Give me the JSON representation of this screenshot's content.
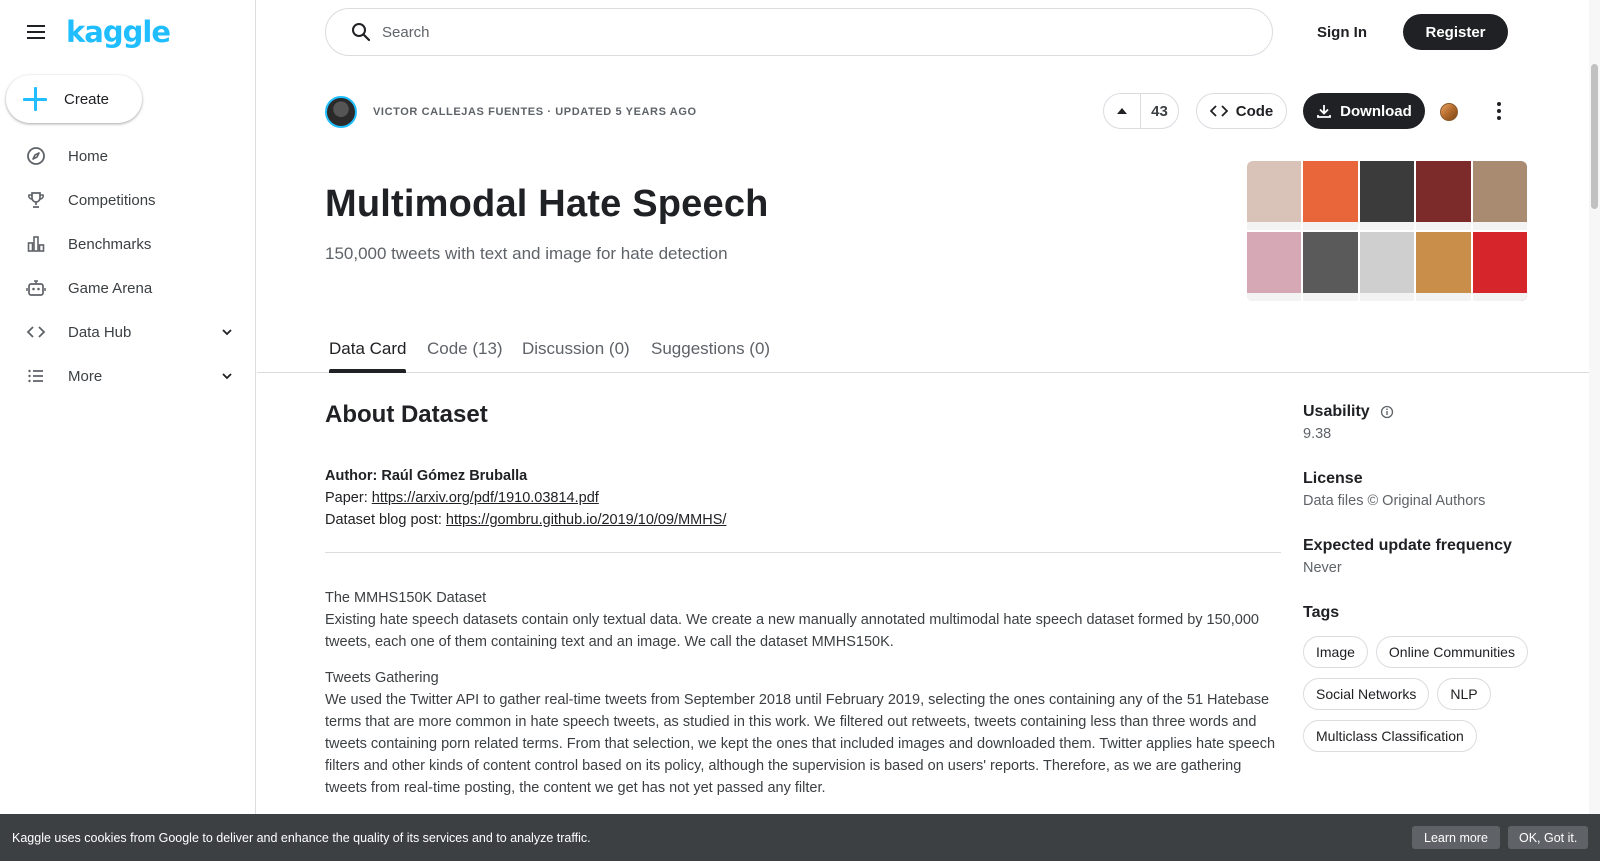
{
  "brand": {
    "logo_text": "kaggle",
    "accent": "#20beff"
  },
  "sidebar": {
    "create_label": "Create",
    "items": [
      {
        "label": "Home",
        "icon": "compass-icon"
      },
      {
        "label": "Competitions",
        "icon": "trophy-icon"
      },
      {
        "label": "Benchmarks",
        "icon": "bar-chart-icon"
      },
      {
        "label": "Game Arena",
        "icon": "robot-icon"
      },
      {
        "label": "Data Hub",
        "icon": "code-brackets-icon",
        "expandable": true
      },
      {
        "label": "More",
        "icon": "list-icon",
        "expandable": true
      }
    ]
  },
  "header": {
    "search_placeholder": "Search",
    "sign_in": "Sign In",
    "register": "Register"
  },
  "dataset": {
    "owner_line": "VICTOR CALLEJAS FUENTES · UPDATED 5 YEARS AGO",
    "votes": "43",
    "code_label": "Code",
    "download_label": "Download",
    "title": "Multimodal Hate Speech",
    "subtitle": "150,000 tweets with text and image for hate detection"
  },
  "tabs": [
    {
      "label": "Data Card",
      "active": true
    },
    {
      "label": "Code (13)"
    },
    {
      "label": "Discussion (0)"
    },
    {
      "label": "Suggestions (0)"
    }
  ],
  "about": {
    "heading": "About Dataset",
    "author": "Author: Raúl Gómez Bruballa",
    "paper_prefix": "Paper: ",
    "paper_link": "https://arxiv.org/pdf/1910.03814.pdf",
    "blog_prefix": "Dataset blog post: ",
    "blog_link": "https://gombru.github.io/2019/10/09/MMHS/",
    "p1_title": "The MMHS150K Dataset",
    "p1_body": "Existing hate speech datasets contain only textual data. We create a new manually annotated multimodal hate speech dataset formed by 150,000 tweets, each one of them containing text and an image. We call the dataset MMHS150K.",
    "p2_title": "Tweets Gathering",
    "p2_body": "We used the Twitter API to gather real-time tweets from September 2018 until February 2019, selecting the ones containing any of the 51 Hatebase terms that are more common in hate speech tweets, as studied in this work. We filtered out retweets, tweets containing less than three words and tweets containing porn related terms. From that selection, we kept the ones that included images and downloaded them. Twitter applies hate speech filters and other kinds of content control based on its policy, although the supervision is based on users' reports. Therefore, as we are gathering tweets from real-time posting, the content we get has not yet passed any filter."
  },
  "side": {
    "usability_label": "Usability",
    "usability_value": "9.38",
    "license_label": "License",
    "license_value": "Data files © Original Authors",
    "freq_label": "Expected update frequency",
    "freq_value": "Never",
    "tags_label": "Tags",
    "tags": [
      "Image",
      "Online Communities",
      "Social Networks",
      "NLP",
      "Multiclass Classification"
    ]
  },
  "cookie": {
    "text": "Kaggle uses cookies from Google to deliver and enhance the quality of its services and to analyze traffic.",
    "learn_more": "Learn more",
    "ok": "OK, Got it."
  },
  "thumbnail": {
    "tile_colors": [
      "#d9c2b8",
      "#e8663a",
      "#3b3b3b",
      "#7d2a2a",
      "#a88b70",
      "#d6a8b5",
      "#5a5a5a",
      "#cfcfcf",
      "#c98f4a",
      "#d7262b"
    ]
  }
}
